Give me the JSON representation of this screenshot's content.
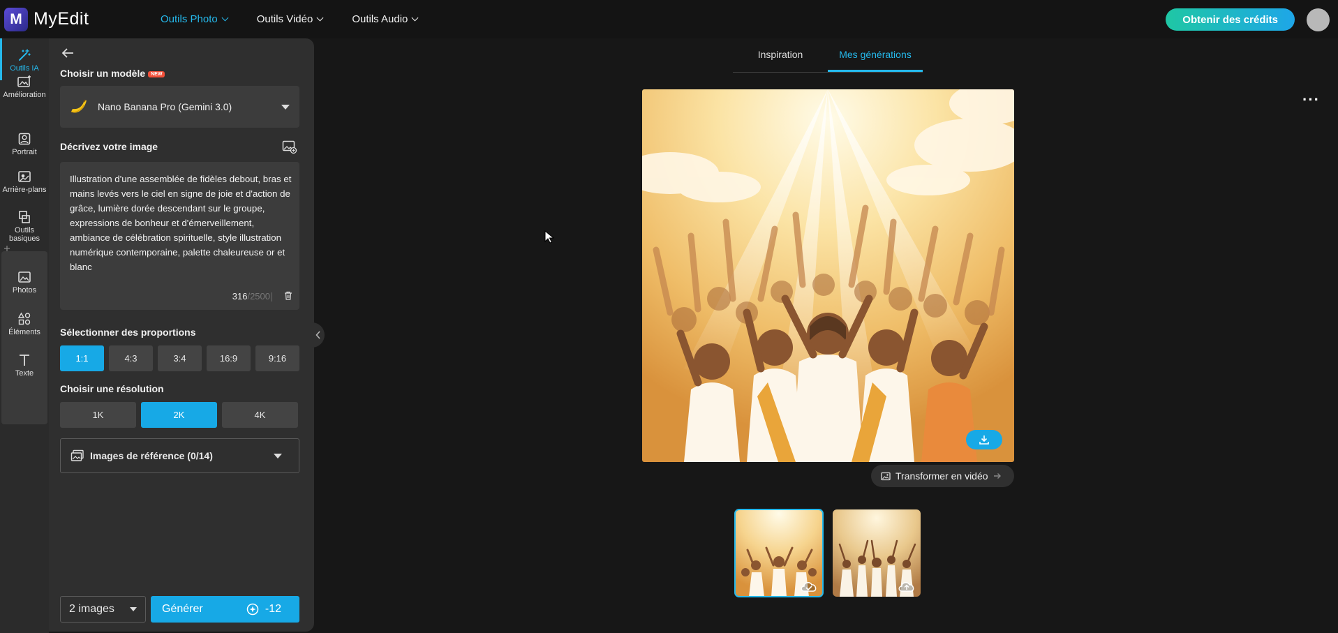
{
  "app": {
    "name": "MyEdit",
    "logo_letter": "M"
  },
  "nav": [
    {
      "label": "Outils Photo",
      "active": true
    },
    {
      "label": "Outils Vidéo",
      "active": false
    },
    {
      "label": "Outils Audio",
      "active": false
    }
  ],
  "header": {
    "credits_button": "Obtenir des crédits"
  },
  "rail": {
    "items": [
      {
        "label": "Outils IA",
        "icon": "magic-wand-icon"
      },
      {
        "label": "Amélioration",
        "icon": "image-enhance-icon"
      },
      {
        "label": "Portrait",
        "icon": "portrait-icon"
      },
      {
        "label": "Arrière-plans",
        "icon": "background-icon"
      },
      {
        "label": "Outils basiques",
        "icon": "crop-icon"
      },
      {
        "label": "Photos",
        "icon": "photo-icon"
      },
      {
        "label": "Éléments",
        "icon": "shapes-icon"
      },
      {
        "label": "Texte",
        "icon": "text-icon"
      }
    ]
  },
  "panel": {
    "model_label": "Choisir un modèle",
    "new_badge": "NEW",
    "model_value": "Nano Banana Pro (Gemini 3.0)",
    "describe_label": "Décrivez votre image",
    "prompt": "Illustration d'une assemblée de fidèles debout, bras et mains levés vers le ciel en signe de joie et d'action de grâce, lumière dorée descendant sur le groupe, expressions de bonheur et d'émerveillement, ambiance de célébration spirituelle, style illustration numérique contemporaine, palette chaleureuse or et blanc",
    "char_count": "316",
    "char_max": "/2500",
    "separator": "|",
    "ratio_label": "Sélectionner des proportions",
    "ratios": [
      "1:1",
      "4:3",
      "3:4",
      "16:9",
      "9:16"
    ],
    "ratio_selected": "1:1",
    "resolution_label": "Choisir une résolution",
    "resolutions": [
      "1K",
      "2K",
      "4K"
    ],
    "resolution_selected": "2K",
    "reference_label": "Images de référence (0/14)",
    "count_value": "2 images",
    "generate_label": "Générer",
    "generate_cost": "-12"
  },
  "tabs": [
    {
      "label": "Inspiration",
      "active": false
    },
    {
      "label": "Mes générations",
      "active": true
    }
  ],
  "preview": {
    "transform_label": "Transformer en vidéo",
    "thumbnails": 2
  },
  "colors": {
    "accent": "#17a9e6",
    "credits_start": "#1fc7a4",
    "credits_end": "#1ea6e8",
    "new_badge": "#f2503a"
  }
}
